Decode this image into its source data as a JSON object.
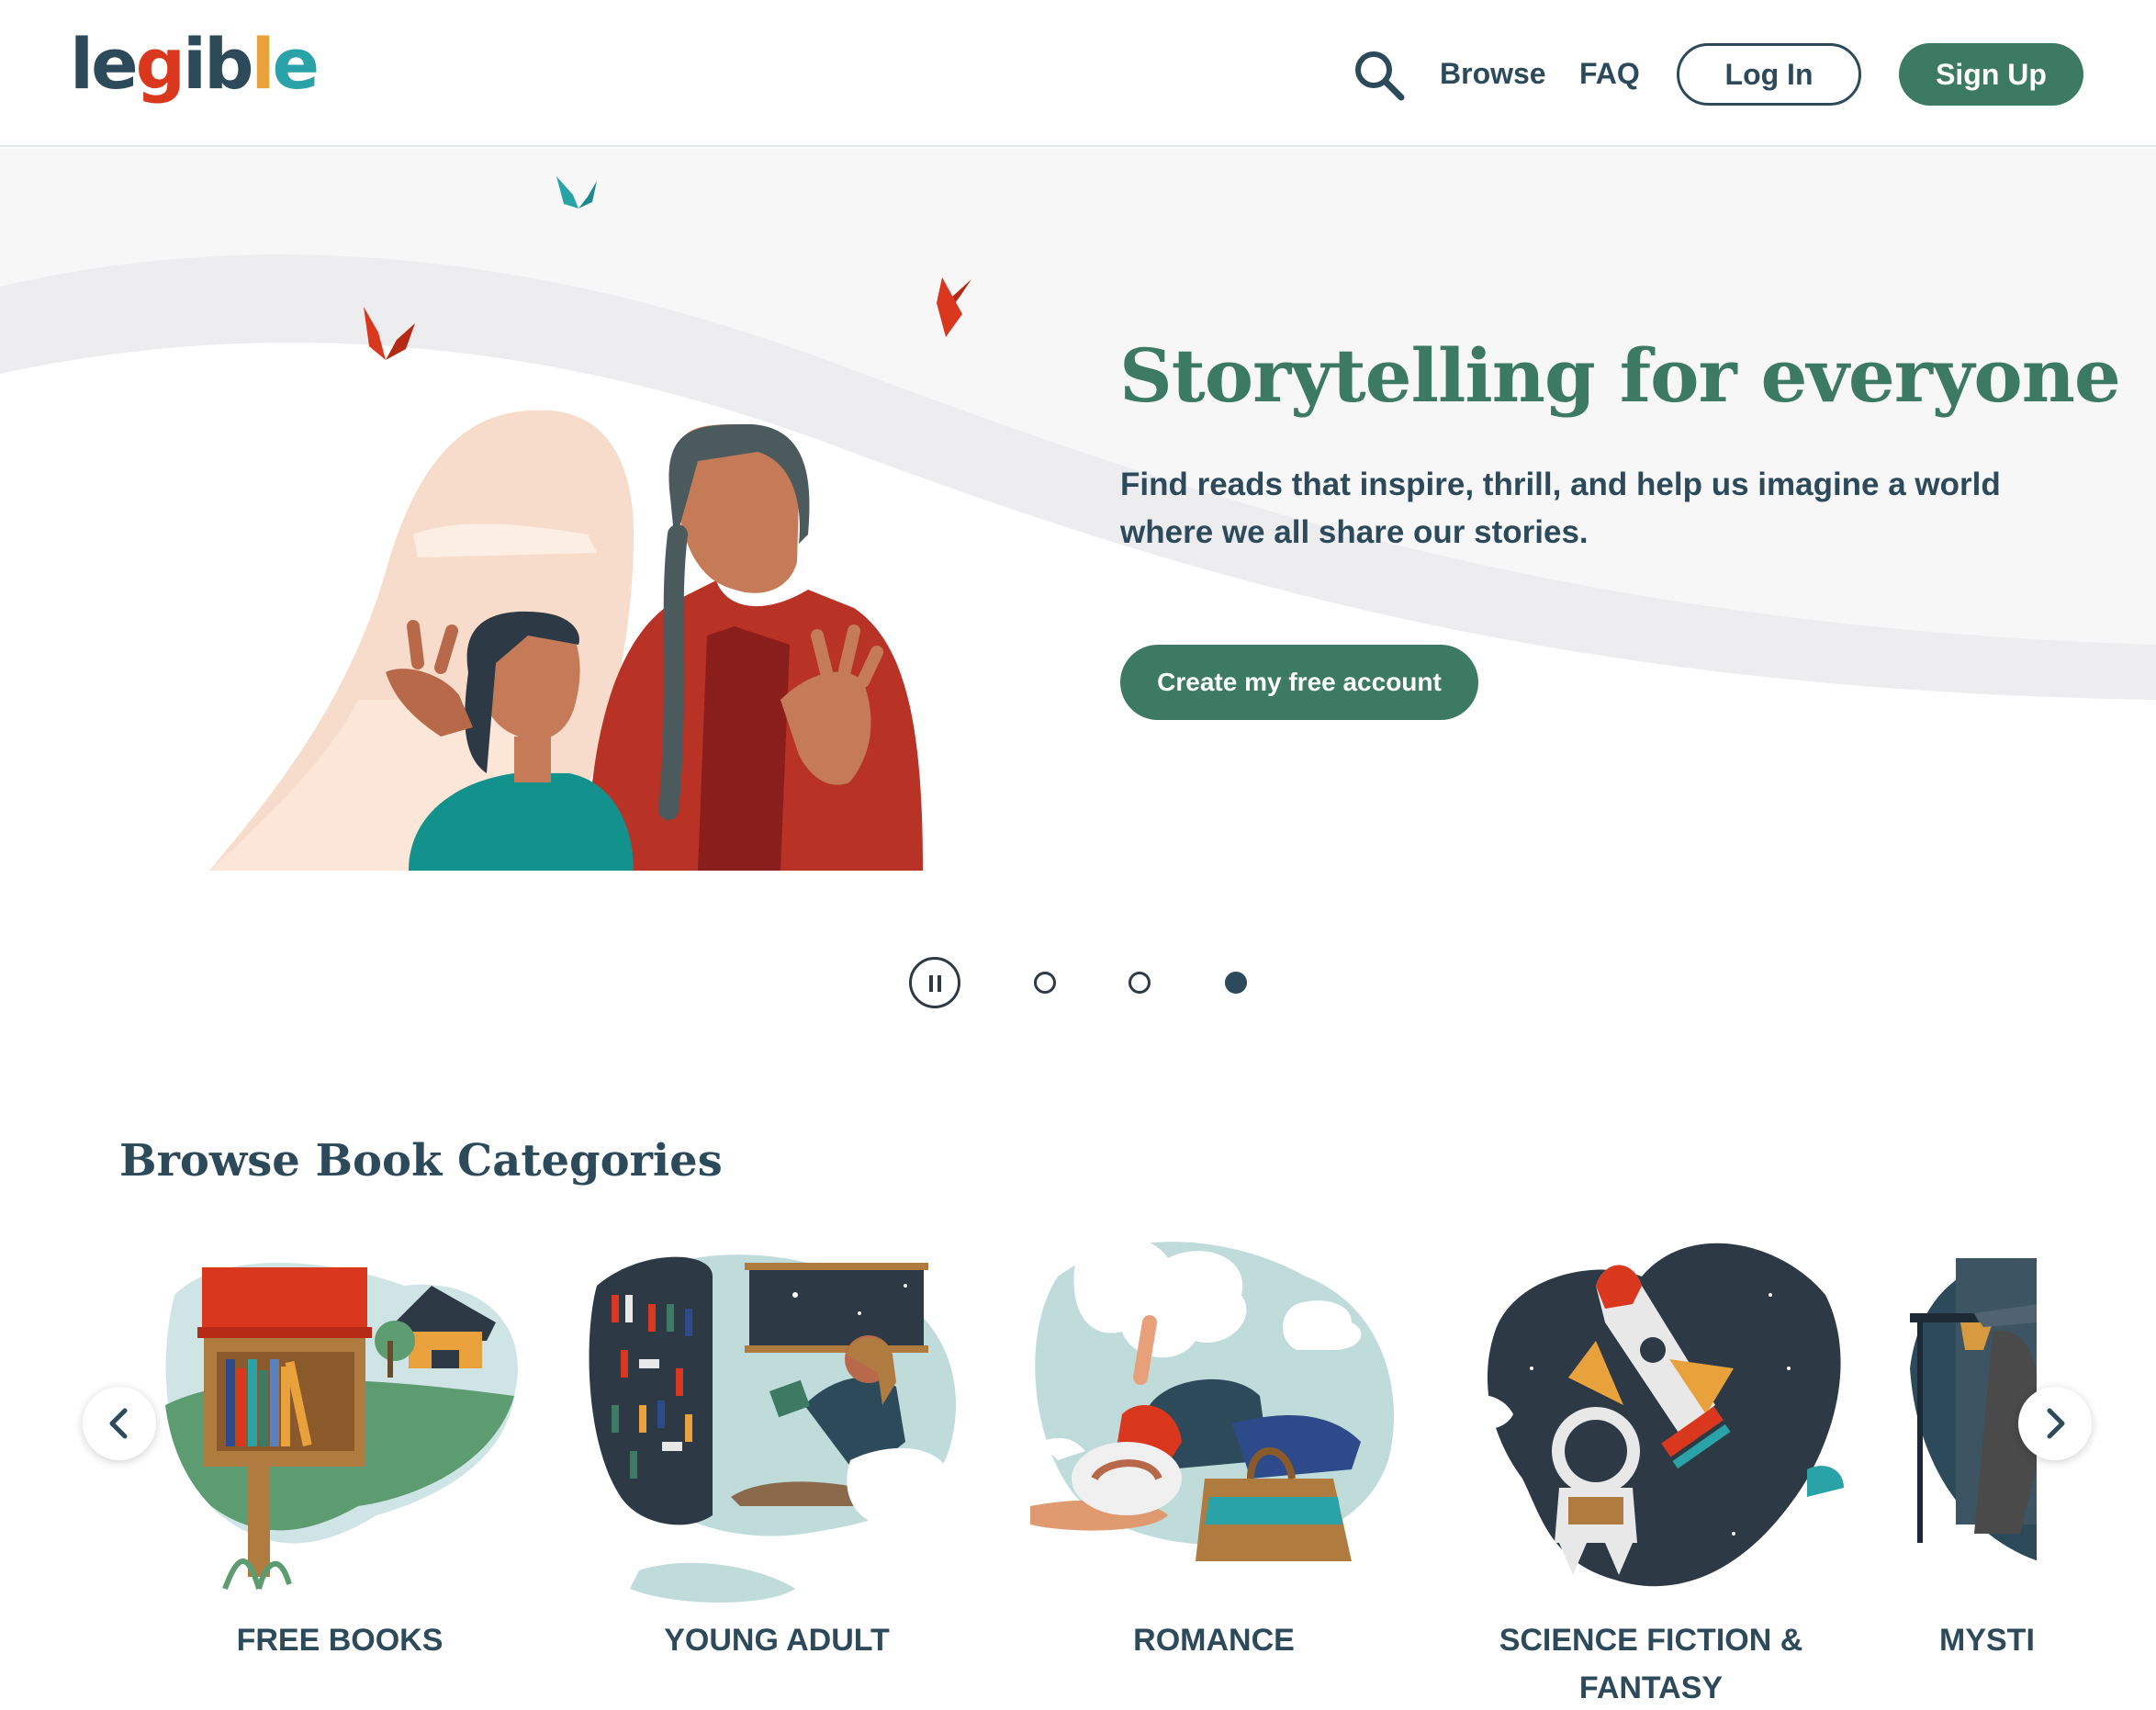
{
  "header": {
    "logo": [
      "l",
      "e",
      "g",
      "i",
      "b",
      "l",
      "e"
    ],
    "logo_colors": [
      "#2d4a5a",
      "#2d4a5a",
      "#d9381e",
      "#2d4a5a",
      "#2d4a5a",
      "#e9a23b",
      "#2aa3a8"
    ],
    "nav": {
      "browse": "Browse",
      "faq": "FAQ",
      "login": "Log In",
      "signup": "Sign Up"
    }
  },
  "hero": {
    "title": "Storytelling for everyone",
    "subtitle": "Find reads that inspire, thrill, and help us imagine a world where we all share our stories.",
    "cta": "Create my free account",
    "slides": {
      "count": 4,
      "active_index": 3
    }
  },
  "categories": {
    "heading": "Browse Book Categories",
    "items": [
      {
        "label": "FREE BOOKS"
      },
      {
        "label": "YOUNG ADULT"
      },
      {
        "label": "ROMANCE"
      },
      {
        "label": "SCIENCE FICTION & FANTASY"
      },
      {
        "label": "MYSTI"
      }
    ]
  },
  "colors": {
    "brand_green": "#3d7a64",
    "navy": "#2d4a5a",
    "hero_bg": "#f7f7f8",
    "accent_red": "#d9381e",
    "accent_teal": "#2aa3a8",
    "accent_yellow": "#e9a23b"
  },
  "icons": {
    "search": "search-icon",
    "pause": "pause-icon",
    "prev": "chevron-left-icon",
    "next": "chevron-right-icon"
  }
}
